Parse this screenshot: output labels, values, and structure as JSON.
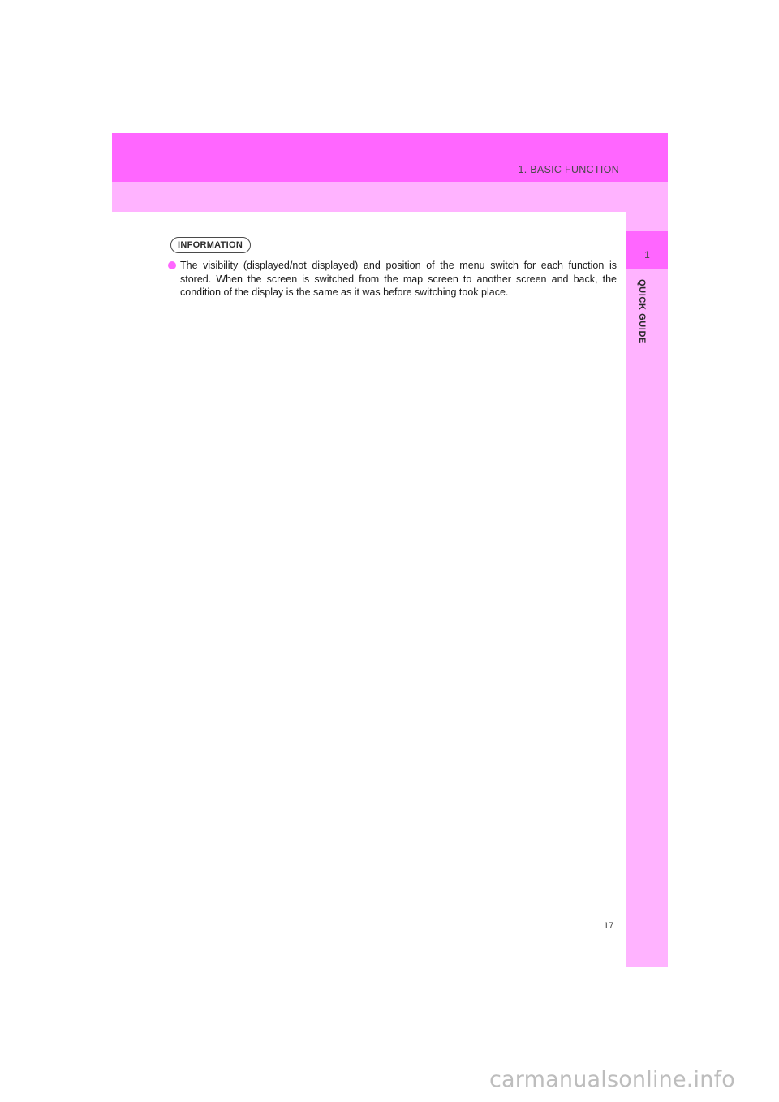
{
  "header": {
    "section_title": "1. BASIC FUNCTION"
  },
  "sidebar": {
    "chapter_number": "1",
    "chapter_label": "QUICK GUIDE"
  },
  "information": {
    "badge": "INFORMATION",
    "items": [
      "The visibility (displayed/not displayed) and position of the menu switch for each function is stored. When the screen is switched from the map screen to another screen and back, the condition of the display is the same as it was before switching took place."
    ]
  },
  "footer": {
    "page_number": "17",
    "watermark": "carmanualsonline.info"
  },
  "colors": {
    "accent": "#ff66ff",
    "accent_light": "#ffb3ff"
  }
}
